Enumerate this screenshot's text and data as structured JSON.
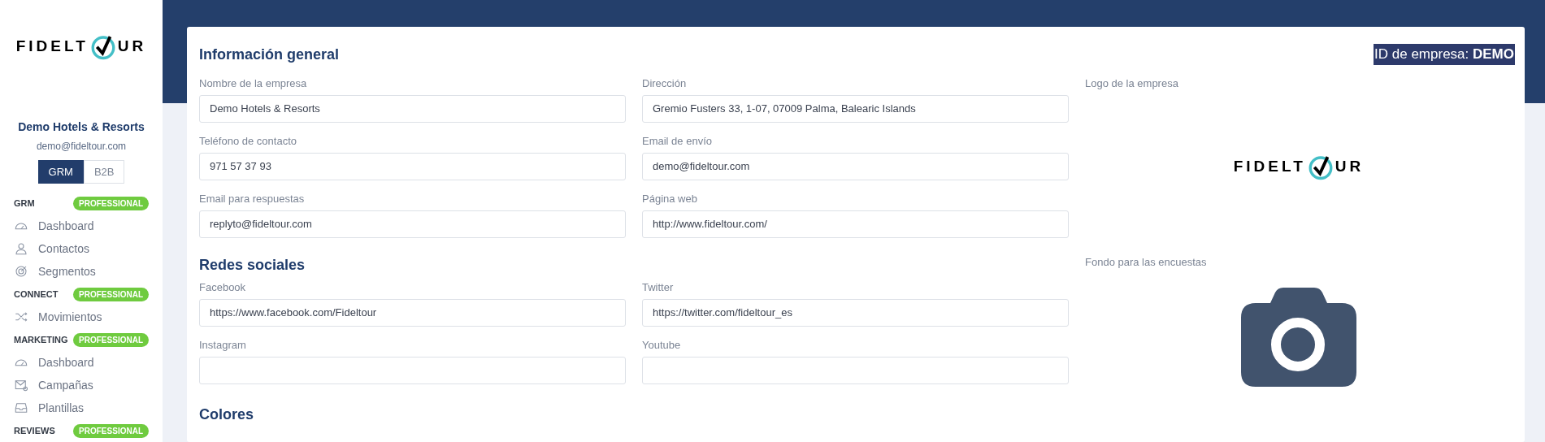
{
  "sidebar": {
    "logo": {
      "left": "FIDELT",
      "right": "UR"
    },
    "company": "Demo Hotels & Resorts",
    "email": "demo@fideltour.com",
    "toggle": [
      {
        "label": "GRM",
        "selected": true
      },
      {
        "label": "B2B",
        "selected": false
      }
    ],
    "sections": [
      {
        "title": "GRM",
        "badge": "PROFESSIONAL",
        "items": [
          {
            "label": "Dashboard",
            "kind": "gauge"
          },
          {
            "label": "Contactos",
            "kind": "user"
          },
          {
            "label": "Segmentos",
            "kind": "target"
          }
        ]
      },
      {
        "title": "CONNECT",
        "badge": "PROFESSIONAL",
        "items": [
          {
            "label": "Movimientos",
            "kind": "shuffle"
          }
        ]
      },
      {
        "title": "MARKETING",
        "badge": "PROFESSIONAL",
        "items": [
          {
            "label": "Dashboard",
            "kind": "gauge"
          },
          {
            "label": "Campañas",
            "kind": "mail"
          },
          {
            "label": "Plantillas",
            "kind": "inbox"
          }
        ]
      },
      {
        "title": "REVIEWS",
        "badge": "PROFESSIONAL"
      }
    ]
  },
  "card": {
    "title": "Información general",
    "company_id": "ID de empresa: **DEMO**",
    "general_fields": [
      {
        "label": "Nombre de la empresa",
        "value": "Demo Hotels & Resorts"
      },
      {
        "label": "Dirección",
        "value": "Gremio Fusters 33, 1-07, 07009 Palma, Balearic Islands"
      },
      {
        "label": "Teléfono de contacto",
        "value": "971 57 37 93"
      },
      {
        "label": "Email de envío",
        "value": "demo@fideltour.com"
      },
      {
        "label": "Email para respuestas",
        "value": "replyto@fideltour.com"
      },
      {
        "label": "Página web",
        "value": "http://www.fideltour.com/"
      }
    ],
    "social_title": "Redes sociales",
    "social_fields": [
      {
        "label": "Facebook",
        "value": "https://www.facebook.com/Fideltour"
      },
      {
        "label": "Twitter",
        "value": "https://twitter.com/fideltour_es"
      },
      {
        "label": "Instagram"
      },
      {
        "label": "Youtube"
      }
    ],
    "colors_title": "Colores",
    "logo_label": "Logo de la empresa",
    "company_logo": {
      "left": "FIDELT",
      "right": "UR"
    },
    "background_label": "Fondo para las encuestas"
  }
}
